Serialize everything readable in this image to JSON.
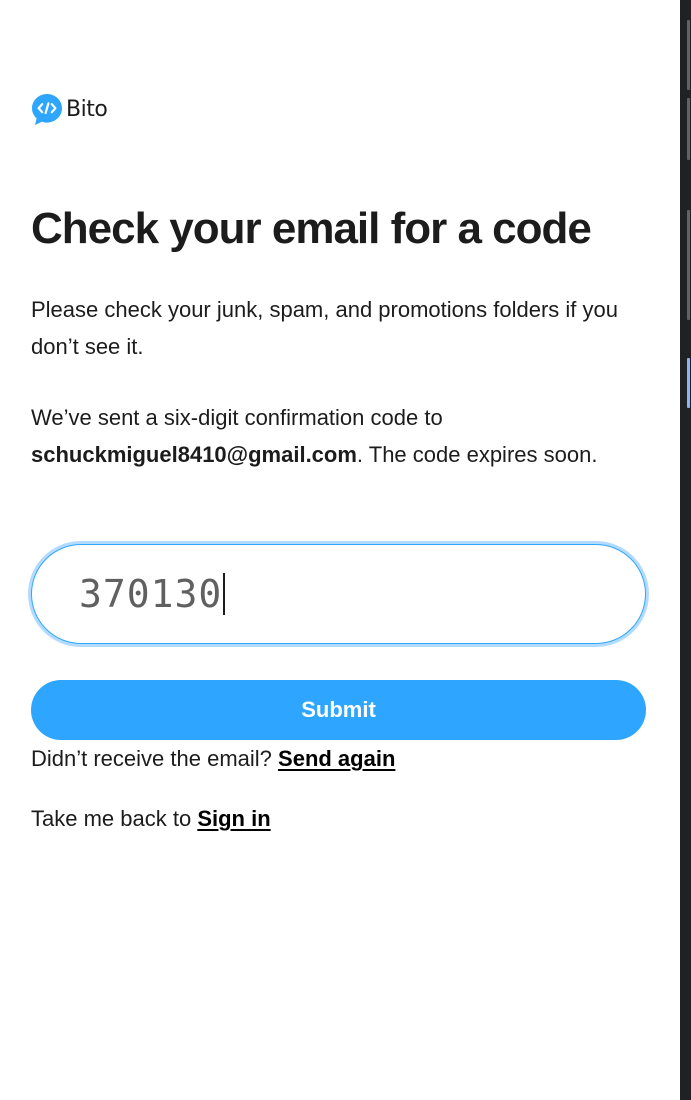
{
  "brand": {
    "name": "Bito",
    "logo_icon": "bito-code-bubble-icon",
    "accent_color": "#2ea6ff"
  },
  "heading": "Check your email for a code",
  "instructions": "Please check your junk, spam, and promotions folders if you don’t see it.",
  "sent_message": {
    "prefix": "We’ve sent a six-digit confirmation code to ",
    "email": "schuckmiguel8410@gmail.com",
    "suffix": ". The code expires soon."
  },
  "code_input": {
    "value": "370130"
  },
  "submit_label": "Submit",
  "resend": {
    "prompt": "Didn’t receive the email?",
    "link_label": "Send again"
  },
  "back": {
    "prompt": "Take me back to",
    "link_label": "Sign in"
  }
}
